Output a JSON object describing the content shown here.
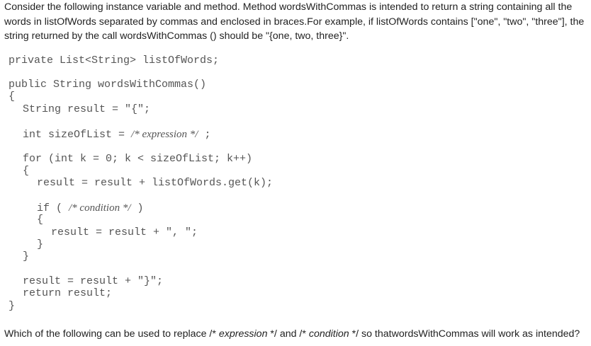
{
  "intro": "Consider the following instance variable and method. Method wordsWithCommas is intended to return a string containing all the words in listOfWords separated by commas and enclosed in braces.For example, if listOfWords contains [\"one\", \"two\", \"three\"], the string returned by the call wordsWithCommas () should be \"{one, two, three}\".",
  "code": {
    "l1": "private List<String> listOfWords;",
    "l2": "public String wordsWithCommas()",
    "l3": "{",
    "l4": "String result = \"{\";",
    "l5_pre": "int sizeOfList = ",
    "l5_comment": "/* expression */",
    "l5_post": " ;",
    "l6": "for (int k = 0; k < sizeOfList; k++)",
    "l7": "{",
    "l8": "result = result + listOfWords.get(k);",
    "l9_pre": "if ( ",
    "l9_comment": "/* condition */",
    "l9_post": " )",
    "l10": "{",
    "l11": "result = result + \", \";",
    "l12": "}",
    "l13": "}",
    "l14": "result = result + \"}\";",
    "l15": "return result;",
    "l16": "}"
  },
  "question": {
    "part1": "Which of the following can be used to replace /* ",
    "expr": "expression",
    "part2": " */ and /* ",
    "cond": "condition",
    "part3": " */ so thatwordsWithCommas will work as intended?"
  }
}
